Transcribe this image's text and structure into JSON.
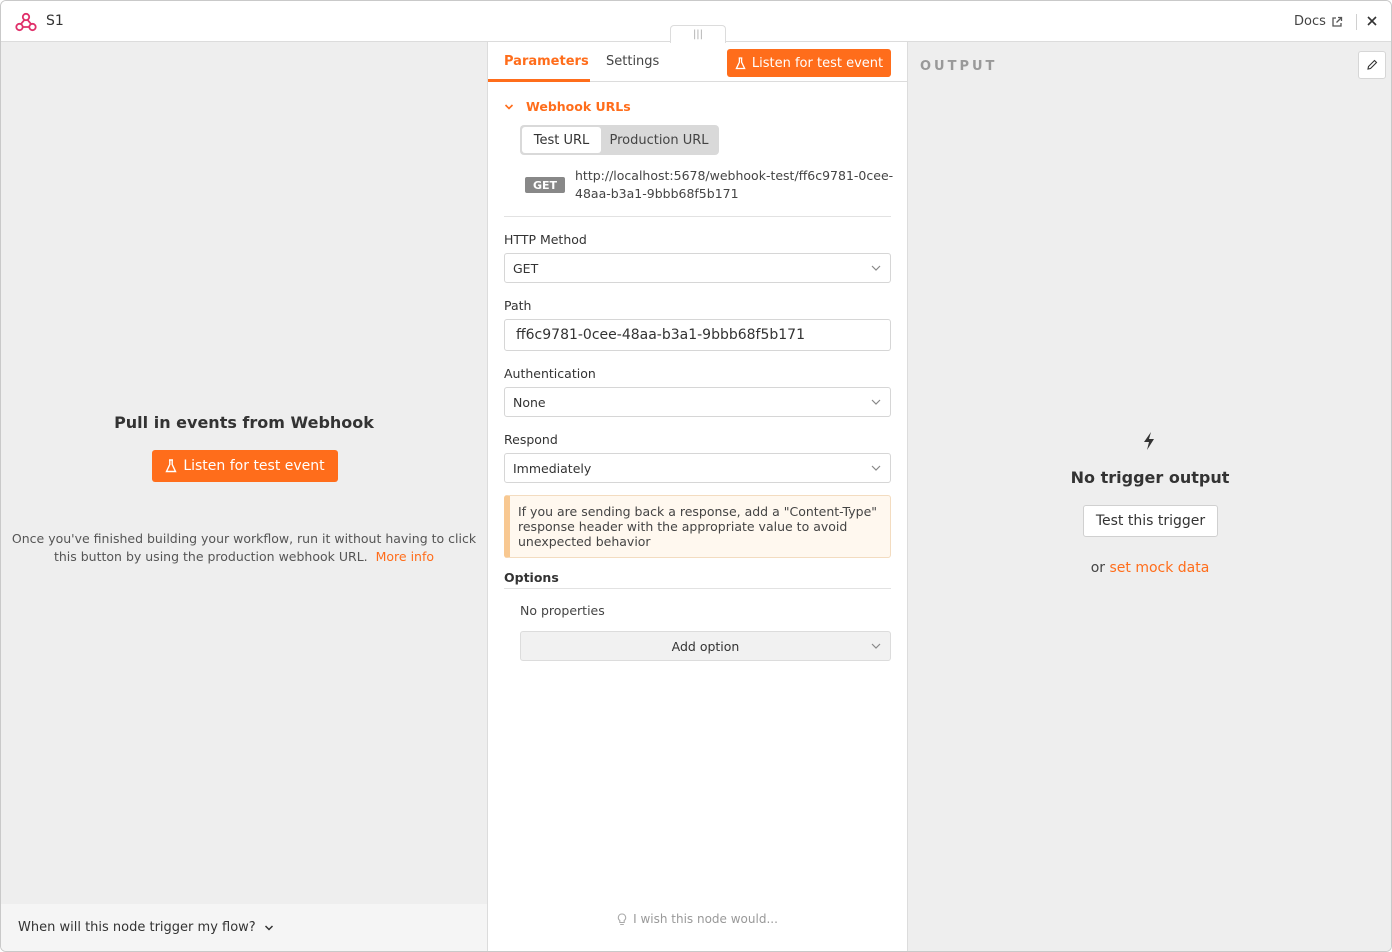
{
  "header": {
    "title": "S1",
    "docs_label": "Docs"
  },
  "left": {
    "heading": "Pull in events from Webhook",
    "listen_button": "Listen for test event",
    "description": "Once you've finished building your workflow, run it without having to click this button by using the production webhook URL.",
    "more_info": "More info",
    "footer_question": "When will this node trigger my flow?"
  },
  "tabs": {
    "parameters": "Parameters",
    "settings": "Settings",
    "listen_button": "Listen for test event"
  },
  "webhook": {
    "section_label": "Webhook URLs",
    "test_url_tab": "Test URL",
    "production_url_tab": "Production URL",
    "method_badge": "GET",
    "url": "http://localhost:5678/webhook-test/ff6c9781-0cee-48aa-b3a1-9bbb68f5b171"
  },
  "fields": {
    "http_method_label": "HTTP Method",
    "http_method_value": "GET",
    "path_label": "Path",
    "path_value": "ff6c9781-0cee-48aa-b3a1-9bbb68f5b171",
    "authentication_label": "Authentication",
    "authentication_value": "None",
    "respond_label": "Respond",
    "respond_value": "Immediately"
  },
  "notice": "If you are sending back a response, add a \"Content-Type\" response header with the appropriate value to avoid unexpected behavior",
  "options": {
    "label": "Options",
    "no_properties": "No properties",
    "add_option": "Add option"
  },
  "wish": "I wish this node would...",
  "output": {
    "label": "OUTPUT",
    "no_output": "No trigger output",
    "test_button": "Test this trigger",
    "or_text": "or",
    "mock_link": "set mock data"
  },
  "colors": {
    "accent": "#ff6d1b",
    "panel_bg": "#eeeeee"
  }
}
